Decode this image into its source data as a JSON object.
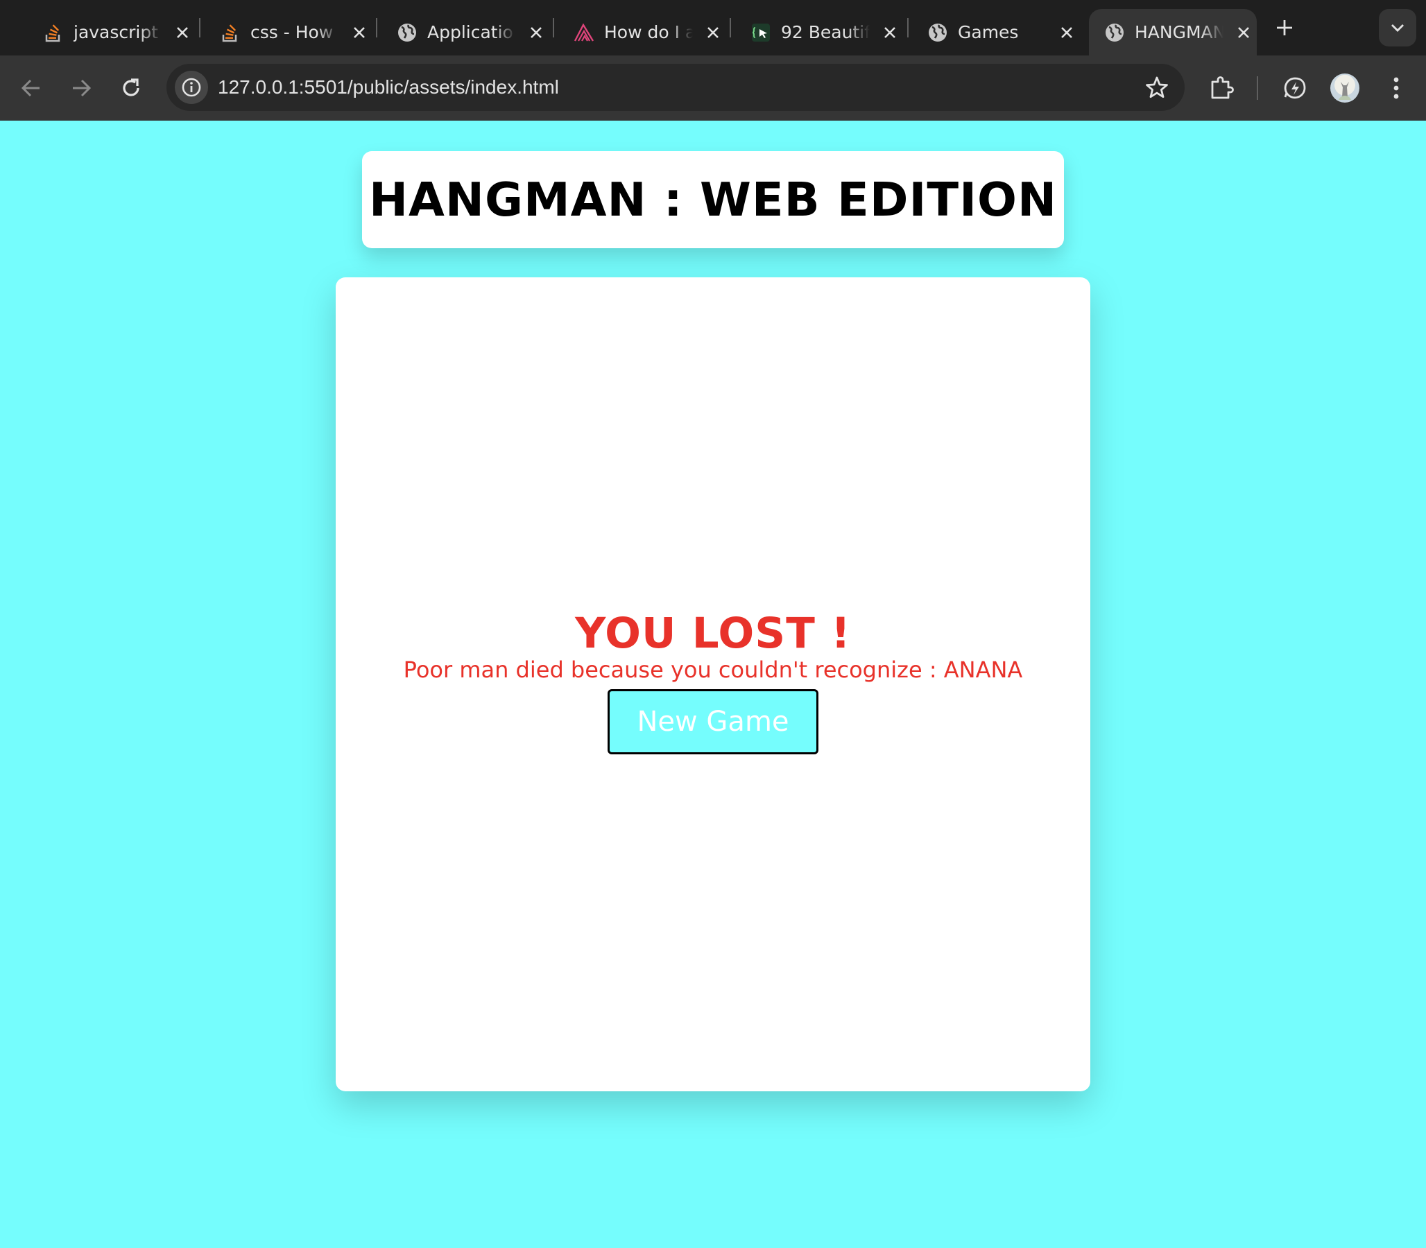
{
  "browser": {
    "tabs": [
      {
        "title": "javascript",
        "icon": "stackoverflow-icon"
      },
      {
        "title": "css - How",
        "icon": "stackoverflow-icon"
      },
      {
        "title": "Applicatio",
        "icon": "globe-icon"
      },
      {
        "title": "How do I a",
        "icon": "sanity-icon"
      },
      {
        "title": "92 Beautif",
        "icon": "cursor-icon"
      },
      {
        "title": "Games",
        "icon": "globe-icon"
      },
      {
        "title": "HANGMAN",
        "icon": "globe-icon",
        "active": true
      }
    ],
    "url": "127.0.0.1:5501/public/assets/index.html"
  },
  "page": {
    "title": "HANGMAN : WEB EDITION",
    "result_title": "YOU LOST !",
    "result_message": "Poor man died because you couldn't recognize : ANANA",
    "new_game_label": "New Game"
  },
  "colors": {
    "page_background": "#75fdfd",
    "lost_text": "#e8322a",
    "button_background": "#75fdfd",
    "chrome_tabstrip": "#1f1f1f",
    "chrome_toolbar": "#353535"
  }
}
